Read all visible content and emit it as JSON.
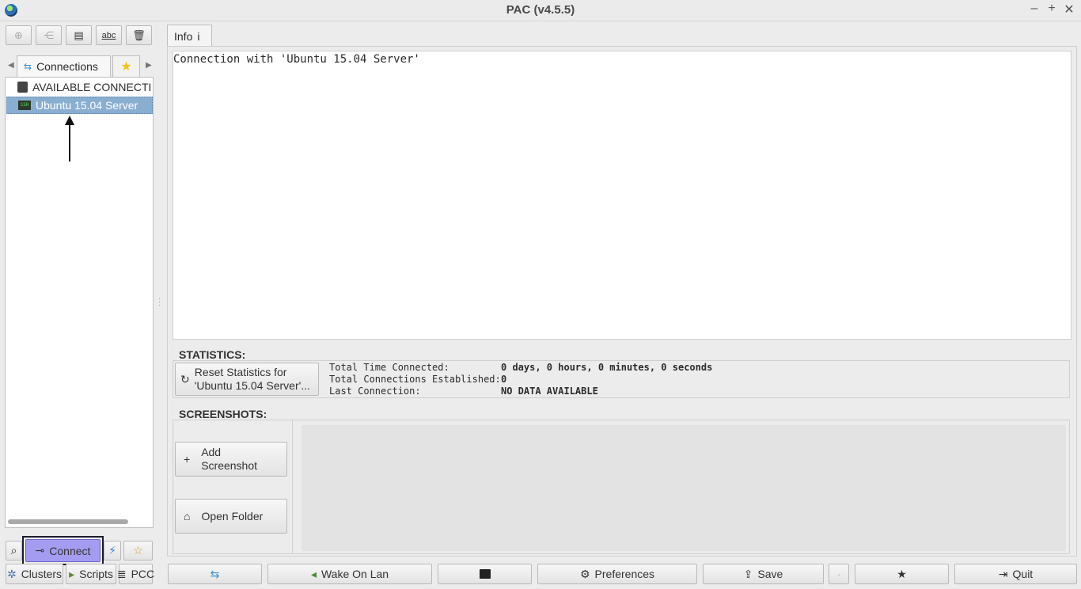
{
  "window": {
    "title": "PAC (v4.5.5)"
  },
  "left_panel": {
    "tabs": [
      {
        "label": "Connections"
      }
    ],
    "tree": [
      {
        "label": "AVAILABLE CONNECTI",
        "selected": false
      },
      {
        "label": "Ubuntu 15.04 Server",
        "selected": true,
        "icon_text": "SSH"
      }
    ],
    "toolbar_icons": [
      "add-node-icon",
      "add-group-icon",
      "edit-icon",
      "rename-icon",
      "trash-icon"
    ],
    "bottom": {
      "connect_label": "Connect"
    },
    "bottom_tabs": [
      "Clusters",
      "Scripts",
      "PCC"
    ]
  },
  "right_panel": {
    "info_tab": {
      "label": "Info",
      "icon": "i"
    },
    "info_text": "Connection with 'Ubuntu 15.04 Server'",
    "statistics": {
      "heading": "STATISTICS:",
      "reset_button": "Reset Statistics for\n'Ubuntu 15.04 Server'...",
      "rows": [
        {
          "key": "Total Time Connected:",
          "value": "0 days, 0 hours, 0 minutes, 0 seconds"
        },
        {
          "key": "Total Connections Established:",
          "value": "0"
        },
        {
          "key": "Last Connection:",
          "value": "NO DATA AVAILABLE"
        }
      ]
    },
    "screenshots": {
      "heading": "SCREENSHOTS:",
      "add_button": "Add\nScreenshot",
      "open_folder_button": "Open Folder"
    }
  },
  "bottom_bar": {
    "wake_on_lan": "Wake On Lan",
    "preferences": "Preferences",
    "save": "Save",
    "quit": "Quit"
  },
  "colors": {
    "selection": "#8aaed0",
    "connect_highlight": "#a39cf0"
  }
}
